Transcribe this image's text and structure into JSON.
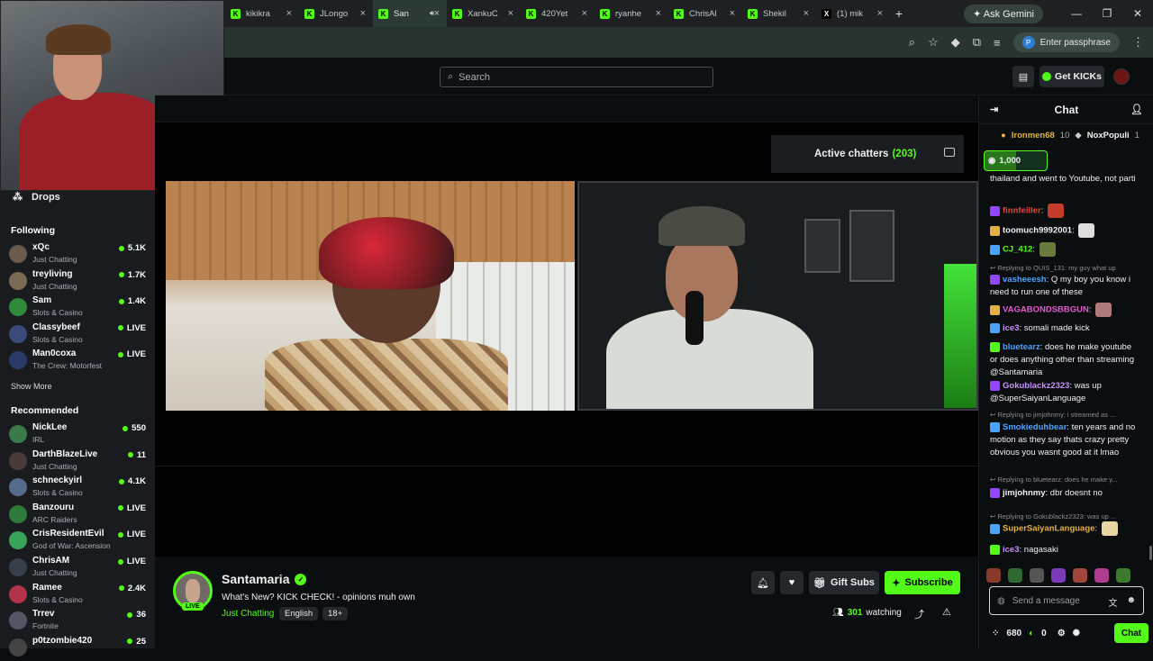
{
  "browser": {
    "tabs": [
      {
        "label": "kikikra",
        "icon": "kick-favicon"
      },
      {
        "label": "JLongo",
        "icon": "kick-favicon"
      },
      {
        "label": "San",
        "icon": "kick-favicon",
        "active": true
      },
      {
        "label": "XankuC",
        "icon": "kick-favicon"
      },
      {
        "label": "420Yet",
        "icon": "kick-favicon"
      },
      {
        "label": "ryanhe",
        "icon": "kick-favicon"
      },
      {
        "label": "ChrisAl",
        "icon": "kick-favicon"
      },
      {
        "label": "Shekil",
        "icon": "kick-favicon"
      },
      {
        "label": "(1) mik",
        "icon": "x-favicon"
      }
    ],
    "ask_gemini": "Ask Gemini",
    "passphrase": "Enter passphrase"
  },
  "topnav": {
    "search_placeholder": "Search",
    "get_kicks": "Get KICKs"
  },
  "sidebar": {
    "drops": "Drops",
    "following_title": "Following",
    "following": [
      {
        "name": "xQc",
        "category": "Just Chatting",
        "value": "5.1K"
      },
      {
        "name": "treyliving",
        "category": "Just Chatting",
        "value": "1.7K"
      },
      {
        "name": "Sam",
        "category": "Slots & Casino",
        "value": "1.4K"
      },
      {
        "name": "Classybeef",
        "category": "Slots & Casino",
        "value": "LIVE"
      },
      {
        "name": "Man0coxa",
        "category": "The Crew: Motorfest",
        "value": "LIVE"
      }
    ],
    "show_more": "Show More",
    "recommended_title": "Recommended",
    "recommended": [
      {
        "name": "NickLee",
        "category": "IRL",
        "value": "550"
      },
      {
        "name": "DarthBlazeLive",
        "category": "Just Chatting",
        "value": "11"
      },
      {
        "name": "schneckyirl",
        "category": "Slots & Casino",
        "value": "4.1K"
      },
      {
        "name": "Banzouru",
        "category": "ARC Raiders",
        "value": "LIVE"
      },
      {
        "name": "CrisResidentEvil",
        "category": "God of War: Ascension",
        "value": "LIVE"
      },
      {
        "name": "ChrisAM",
        "category": "Just Chatting",
        "value": "LIVE"
      },
      {
        "name": "Ramee",
        "category": "Slots & Casino",
        "value": "2.4K"
      },
      {
        "name": "Trrev",
        "category": "Fortnite",
        "value": "36"
      },
      {
        "name": "p0tzombie420",
        "category": "",
        "value": "25"
      }
    ]
  },
  "stream": {
    "active_chatters_label": "Active chatters",
    "active_chatters_count": "(203)"
  },
  "channel": {
    "name": "Santamaria",
    "live": "LIVE",
    "title": "What's New? KICK CHECK! - opinions muh own",
    "category": "Just Chatting",
    "tags": [
      "English",
      "18+"
    ],
    "gift_subs": "Gift Subs",
    "subscribe": "Subscribe",
    "watching_count": "301",
    "watching_label": "watching"
  },
  "chat": {
    "title": "Chat",
    "pinned": {
      "gifter": "Ironmen68",
      "gift_count": "10",
      "second": "NoxPopuli",
      "second_count": "1"
    },
    "kicks_badge": "1,000",
    "messages": [
      {
        "type": "msg",
        "user": "",
        "color": "#efeff1",
        "text": "thailand and went to Youtube, not parti"
      },
      {
        "type": "msg",
        "user": "finnfeiller",
        "color": "#e8433f",
        "text": ""
      },
      {
        "type": "msg",
        "user": "toomuch9992001",
        "color": "#efeff1",
        "text": ""
      },
      {
        "type": "msg",
        "user": "CJ_412",
        "color": "#53fc18",
        "text": ""
      },
      {
        "type": "reply",
        "text": "Replying to QUIS_131: my guy what up"
      },
      {
        "type": "msg",
        "user": "vasheeesh",
        "color": "#4aa3ff",
        "text": "Q my boy you know i need to run one of these"
      },
      {
        "type": "msg",
        "user": "VAGABONDSBBGUN",
        "color": "#e35bd3",
        "text": ""
      },
      {
        "type": "msg",
        "user": "ice3",
        "color": "#c991ff",
        "text": "somali made kick"
      },
      {
        "type": "msg",
        "user": "bluetearz",
        "color": "#4aa3ff",
        "text": "does he make youtube or does anything other than streaming @Santamaria"
      },
      {
        "type": "msg",
        "user": "Gokublackz2323",
        "color": "#c991ff",
        "text": "was up @SuperSaiyanLanguage"
      },
      {
        "type": "reply",
        "text": "Replying to jimjohnmy: i streamed as ..."
      },
      {
        "type": "msg",
        "user": "Smokieduhbear",
        "color": "#4aa3ff",
        "text": "ten years and no motion as they say thats crazy pretty obvious you wasnt good at it lmao"
      },
      {
        "type": "reply",
        "text": "Replying to bluetearz: does he make y..."
      },
      {
        "type": "msg",
        "user": "jimjohnmy",
        "color": "#efeff1",
        "text": "dbr doesnt no"
      },
      {
        "type": "reply",
        "text": "Replying to Gokublackz2323: was up ..."
      },
      {
        "type": "msg",
        "user": "SuperSaiyanLanguage",
        "color": "#e3b341",
        "text": ""
      },
      {
        "type": "msg",
        "user": "ice3",
        "color": "#c991ff",
        "text": "nagasaki"
      }
    ],
    "input_placeholder": "Send a message",
    "kicks_balance": "680",
    "points": "0",
    "send": "Chat"
  }
}
